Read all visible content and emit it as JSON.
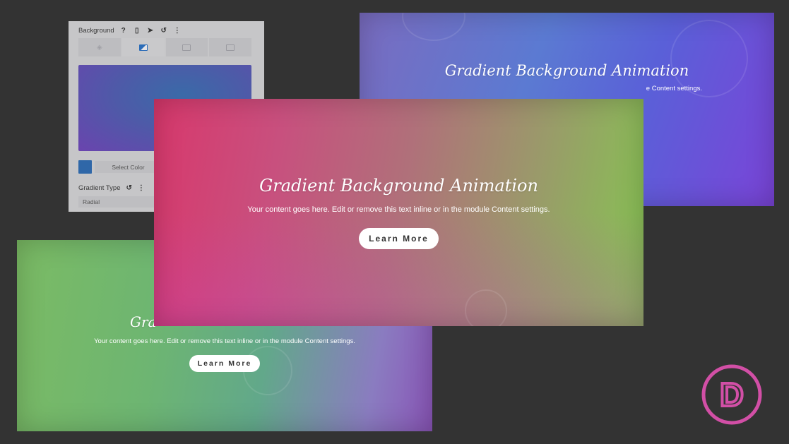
{
  "settings_panel": {
    "section_label": "Background",
    "header_icons": [
      "help-icon",
      "mobile-icon",
      "cursor-icon",
      "undo-icon",
      "more-vertical-icon"
    ],
    "tabs": [
      {
        "icon": "color-fill-icon",
        "active": false
      },
      {
        "icon": "gradient-icon",
        "active": true
      },
      {
        "icon": "image-icon",
        "active": false
      },
      {
        "icon": "video-icon",
        "active": false
      }
    ],
    "select_color_label": "Select Color",
    "swatch_color": "#2f67a8",
    "gradient_type_label": "Gradient Type",
    "gradient_type_value": "Radial"
  },
  "cards": {
    "top_right": {
      "title": "Gradient Background Animation",
      "body_visible": "e Content settings.",
      "gradient_colors": [
        "#7a6cc0",
        "#5b7ad2",
        "#7a44d8"
      ]
    },
    "center": {
      "title": "Gradient Background Animation",
      "body": "Your content goes here. Edit or remove this text inline or in the module Content settings.",
      "button_label": "Learn More",
      "gradient_colors": [
        "#d8386c",
        "#b0707a",
        "#86c452"
      ]
    },
    "bottom_left": {
      "title_visible": "Gra",
      "body": "Your content goes here. Edit or remove this text inline or in the module Content settings.",
      "button_label": "Learn More",
      "gradient_colors": [
        "#7bbb64",
        "#62a88a",
        "#8a55b8"
      ]
    }
  },
  "brand": {
    "logo_letter": "D",
    "logo_color": "#d24fa6"
  }
}
